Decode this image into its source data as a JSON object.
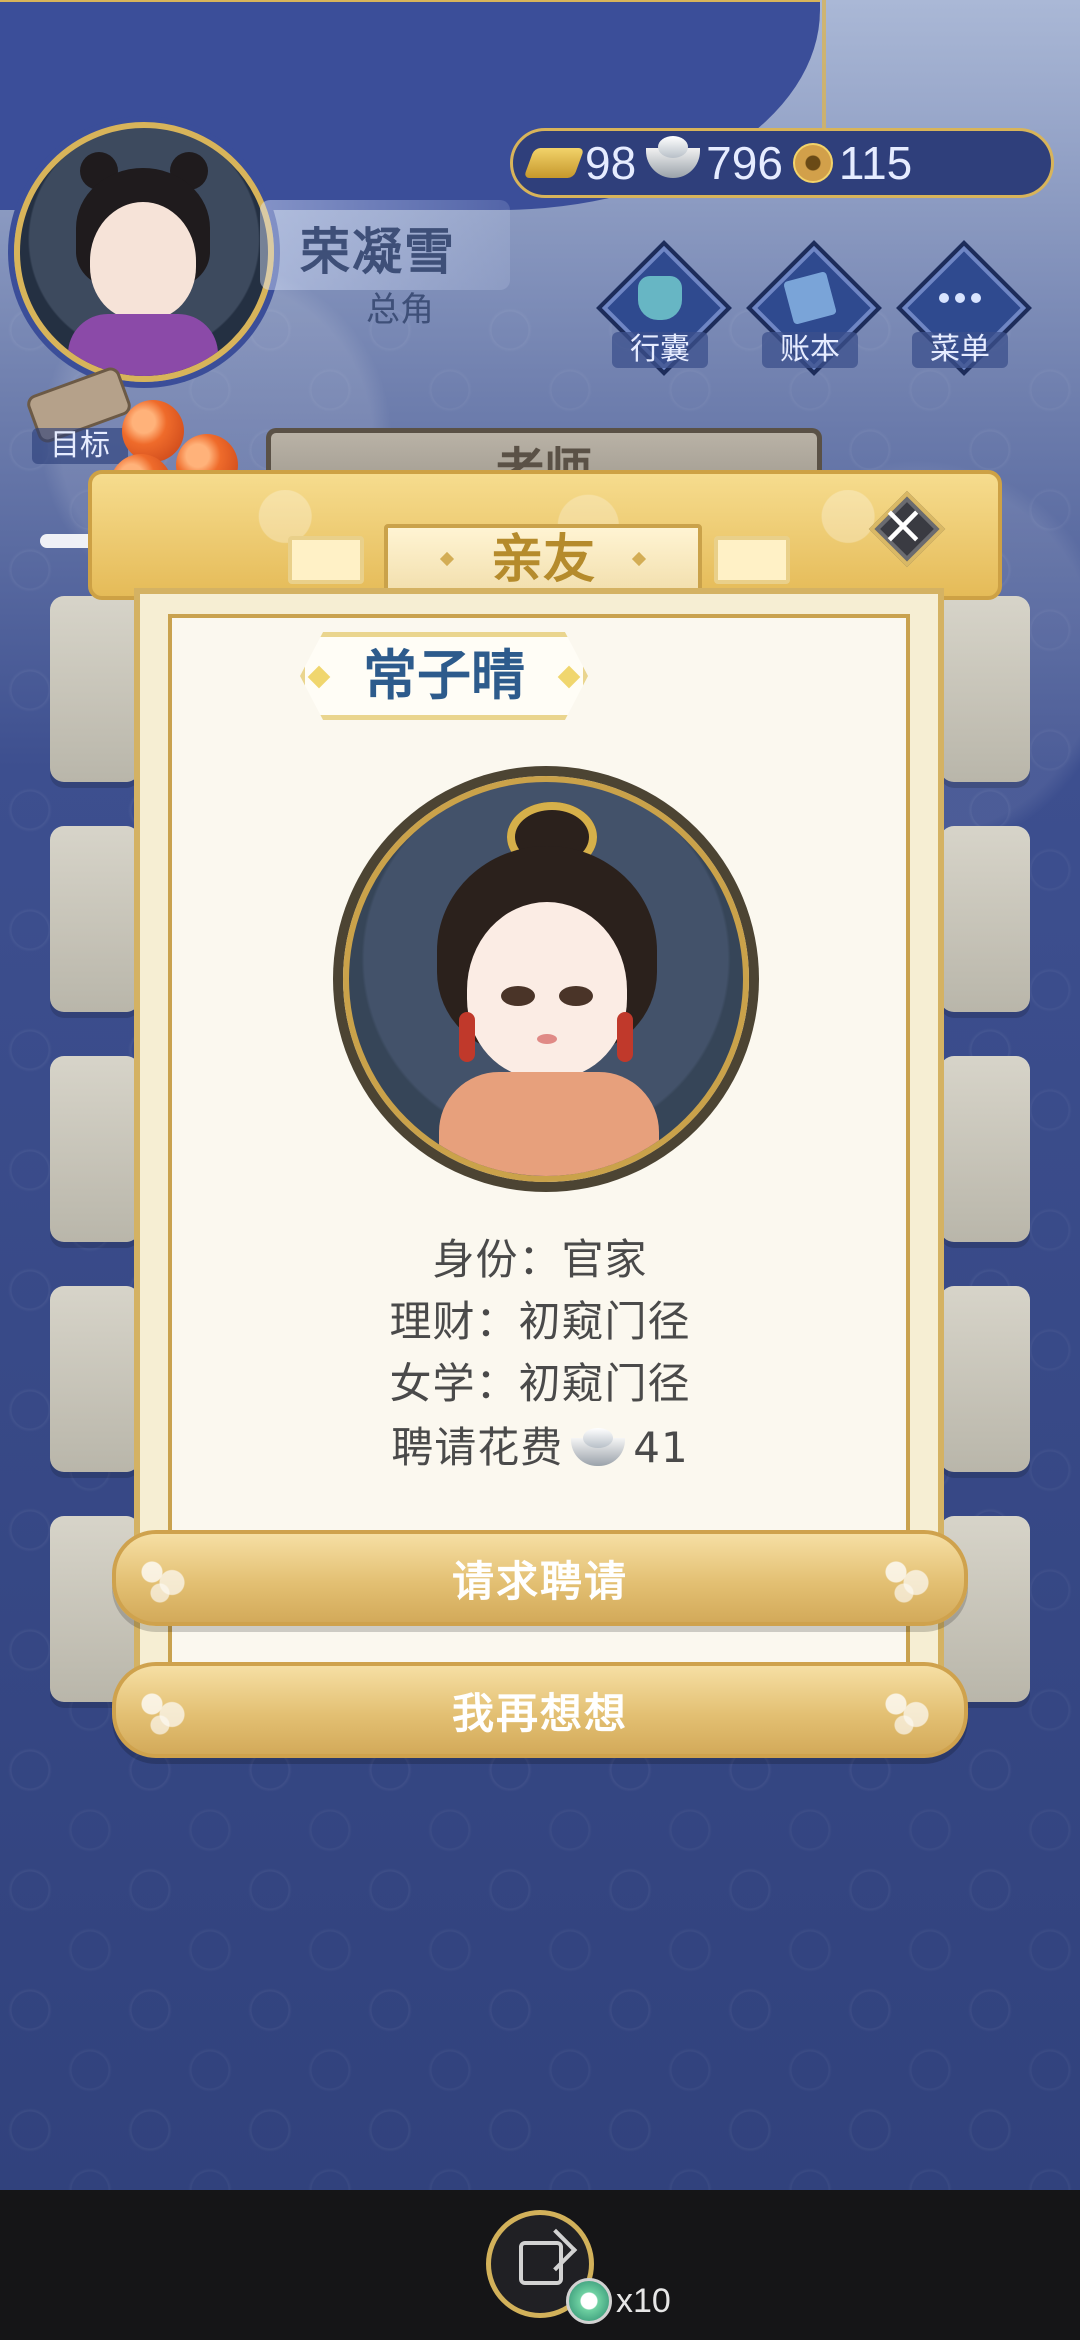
{
  "header": {
    "player_name": "荣凝雪",
    "player_title": "总角",
    "currencies": [
      {
        "icon": "gold-bar-icon",
        "value": "98"
      },
      {
        "icon": "silver-ingot-icon",
        "value": "796"
      },
      {
        "icon": "copper-coin-icon",
        "value": "115"
      }
    ],
    "buttons": [
      {
        "label": "行囊"
      },
      {
        "label": "账本"
      },
      {
        "label": "菜单"
      }
    ],
    "target_label": "目标"
  },
  "background": {
    "teacher_label": "老师"
  },
  "modal": {
    "title": "亲友",
    "close_symbol": "×",
    "character_name": "常子晴",
    "info": {
      "identity": {
        "label": "身份",
        "separator": "：",
        "value": "官家"
      },
      "finance": {
        "label": "理财",
        "separator": "：",
        "value": "初窥门径"
      },
      "education": {
        "label": "女学",
        "separator": "：",
        "value": "初窥门径"
      },
      "cost": {
        "label": "聘请花费",
        "value": "41"
      }
    },
    "buttons": {
      "request": "请求聘请",
      "think": "我再想想"
    }
  },
  "bottom": {
    "count": "x10"
  },
  "colors": {
    "accent_gold": "#d8b45a",
    "panel_bg": "#fbf8ef",
    "name_blue": "#2d5b8c",
    "dark_bar": "#151517"
  }
}
